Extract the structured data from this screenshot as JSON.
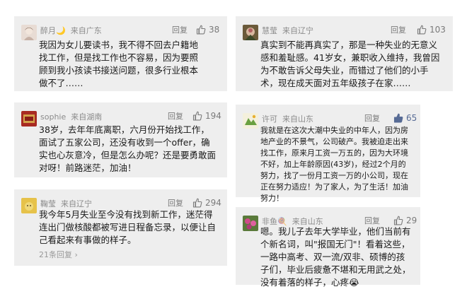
{
  "comments": [
    {
      "user": "醉月🌙",
      "location": "来自广东",
      "reply_label": "回复",
      "likes": "38",
      "liked": false,
      "text": "我因为女儿要读书，我不得不回去户籍地找工作，但是找工作也不容易，因为要照顾到我小孩读书接送问题，很多行业根本做不了……"
    },
    {
      "user": "慧莹",
      "location": "来自辽宁",
      "reply_label": "回复",
      "likes": "103",
      "liked": false,
      "text": "真实到不能再真实了，那是一种失业的无意义感和羞耻感。41岁女，兼职收入维持，我曾因为不敢告诉父母失业，而错过了他们的小手术，现在成天面对五年级孩子在家……"
    },
    {
      "user": "sophie",
      "location": "来自湖南",
      "reply_label": "回复",
      "likes": "194",
      "liked": false,
      "text": "38岁，去年年底离职，六月份开始找工作，面试了五家公司，还没有收到一个offer，确实也心灰意冷，但是怎么办呢？还是要勇敢面对呀！前路迷茫，加油！"
    },
    {
      "user": "许可",
      "location": "来自山东",
      "reply_label": "回复",
      "likes": "65",
      "liked": true,
      "text": "我就是在这次大潮中失业的中年人，因为房地产业的不景气，公司破产。我被迫走出来找工作，原来月工资一万五的，因为大环境不好，加上年龄原因(43岁)，经过2个月的努力，找了一份月工资一万的小公司，现在正在努力适应！为了家人，为了生活！加油努力！"
    },
    {
      "user": "鞠莹",
      "location": "来自辽宁",
      "reply_label": "回复",
      "likes": "294",
      "liked": false,
      "text": "我今年5月失业至今没有找到新工作，迷茫得连出门做核酸都被写进日程备忘录，以便让自己看起来有事做的样子。",
      "more": "21条回复"
    },
    {
      "user": "非鱼🍭",
      "location": "来自山东",
      "reply_label": "回复",
      "likes": "29",
      "liked": false,
      "text": "嗯。我儿子去年大学毕业，他们当前有个新名词，叫\"报国无门\"！看着这些，一路中高考、双一流/双非、硕博的孩子们，毕业后疲惫不堪和无用武之处，没有着落的样子，心疼😭"
    }
  ]
}
